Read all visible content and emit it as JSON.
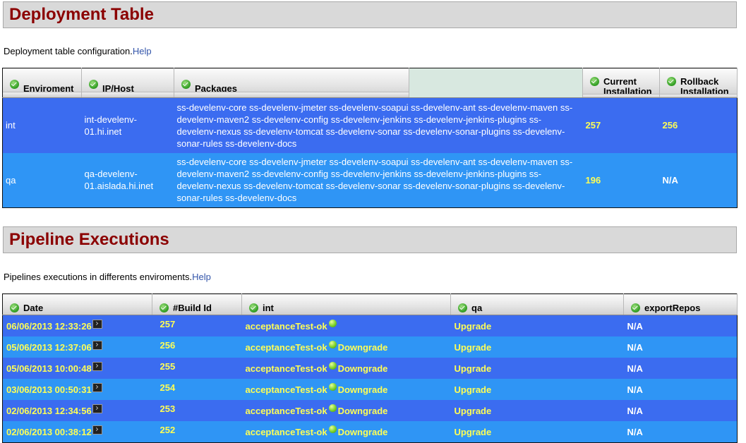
{
  "deployment": {
    "title": "Deployment Table",
    "description": "Deployment table configuration.",
    "help": "Help",
    "columns": {
      "env": "Enviroment",
      "host": "IP/Host",
      "packages": "Packages",
      "current": "Current Installation",
      "rollback": "Rollback Installation"
    },
    "rows": [
      {
        "env": "int",
        "host": "int-develenv-01.hi.inet",
        "packages": "ss-develenv-core ss-develenv-jmeter ss-develenv-soapui ss-develenv-ant ss-develenv-maven ss-develenv-maven2 ss-develenv-config ss-develenv-jenkins ss-develenv-jenkins-plugins ss-develenv-nexus ss-develenv-tomcat ss-develenv-sonar ss-develenv-sonar-plugins ss-develenv-sonar-rules ss-develenv-docs",
        "current": "257",
        "rollback": "256"
      },
      {
        "env": "qa",
        "host": "qa-develenv-01.aislada.hi.inet",
        "packages": "ss-develenv-core ss-develenv-jmeter ss-develenv-soapui ss-develenv-ant ss-develenv-maven ss-develenv-maven2 ss-develenv-config ss-develenv-jenkins ss-develenv-jenkins-plugins ss-develenv-nexus ss-develenv-tomcat ss-develenv-sonar ss-develenv-sonar-plugins ss-develenv-sonar-rules ss-develenv-docs",
        "current": "196",
        "rollback": "N/A"
      }
    ]
  },
  "pipeline": {
    "title": "Pipeline Executions",
    "description": "Pipelines executions in differents enviroments.",
    "help": "Help",
    "columns": {
      "date": "Date",
      "build": "#Build Id",
      "int": "int",
      "qa": "qa",
      "export": "exportRepos"
    },
    "rows": [
      {
        "date": "06/06/2013 12:33:26",
        "build": "257",
        "int": "acceptanceTest-ok",
        "downgrade": "",
        "qa": "Upgrade",
        "export": "N/A"
      },
      {
        "date": "05/06/2013 12:37:06",
        "build": "256",
        "int": "acceptanceTest-ok",
        "downgrade": "Downgrade",
        "qa": "Upgrade",
        "export": "N/A"
      },
      {
        "date": "05/06/2013 10:00:48",
        "build": "255",
        "int": "acceptanceTest-ok",
        "downgrade": "Downgrade",
        "qa": "Upgrade",
        "export": "N/A"
      },
      {
        "date": "03/06/2013 00:50:31",
        "build": "254",
        "int": "acceptanceTest-ok",
        "downgrade": "Downgrade",
        "qa": "Upgrade",
        "export": "N/A"
      },
      {
        "date": "02/06/2013 12:34:56",
        "build": "253",
        "int": "acceptanceTest-ok",
        "downgrade": "Downgrade",
        "qa": "Upgrade",
        "export": "N/A"
      },
      {
        "date": "02/06/2013 00:38:12",
        "build": "252",
        "int": "acceptanceTest-ok",
        "downgrade": "Downgrade",
        "qa": "Upgrade",
        "export": "N/A"
      }
    ]
  },
  "colors": {
    "header_text": "#8b0000",
    "row_dark": "#3b6cf0",
    "row_light": "#2f95f5",
    "highlight_text": "#ffff55",
    "link": "#3355aa"
  }
}
